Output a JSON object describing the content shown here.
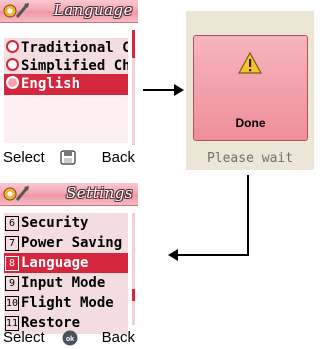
{
  "language_screen": {
    "title": "Language",
    "items": [
      {
        "label": "Traditional C",
        "selected": false
      },
      {
        "label": "Simplified Chi",
        "selected": false
      },
      {
        "label": "English",
        "selected": true
      }
    ],
    "softkeys": {
      "left": "Select",
      "middle_icon": "menu-icon",
      "right": "Back"
    }
  },
  "wait_screen": {
    "dialog_icon": "warning-icon",
    "dialog_text": "Done",
    "status": "Please wait"
  },
  "settings_screen": {
    "title": "Settings",
    "items": [
      {
        "number": "6",
        "label": "Security",
        "selected": false
      },
      {
        "number": "7",
        "label": "Power Saving",
        "selected": false
      },
      {
        "number": "8",
        "label": "Language",
        "selected": true
      },
      {
        "number": "9",
        "label": "Input Mode",
        "selected": false
      },
      {
        "number": "10",
        "label": "Flight Mode",
        "selected": false
      },
      {
        "number": "11",
        "label": "Restore",
        "selected": false
      }
    ],
    "softkeys": {
      "left": "Select",
      "middle_icon": "ok-icon",
      "right": "Back"
    }
  },
  "colors": {
    "accent": "#d4263d",
    "title_bar": "#f3a9b4",
    "list_background": "#f4dde0",
    "wait_background": "#ece6d6"
  }
}
